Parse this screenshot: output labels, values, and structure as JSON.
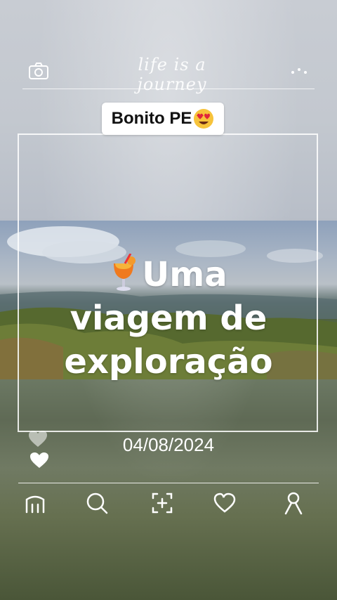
{
  "header": {
    "script_text": "life is a journey",
    "camera_icon": "camera-icon",
    "more_icon": "more-dots-icon"
  },
  "tag": {
    "label": "Bonito PE",
    "emoji": "heart-eyes-emoji"
  },
  "title": {
    "line1": "Uma",
    "line2": "viagem de",
    "line3": "exploração",
    "emoji": "tropical-drink-emoji"
  },
  "date": "04/08/2024",
  "nav": {
    "items": [
      "home-icon",
      "search-icon",
      "add-icon",
      "heart-icon",
      "profile-icon"
    ]
  },
  "colors": {
    "text": "#ffffff",
    "tag_bg": "#ffffff",
    "tag_text": "#111111"
  }
}
